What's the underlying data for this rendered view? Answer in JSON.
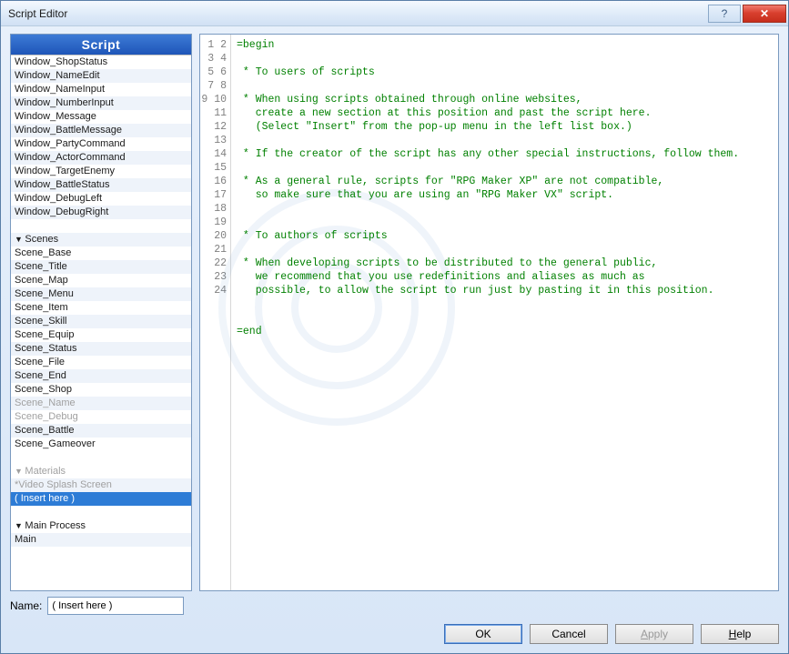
{
  "window": {
    "title": "Script Editor"
  },
  "titlebar": {
    "help_glyph": "?",
    "close_glyph": "✕"
  },
  "sidebar": {
    "header": "Script",
    "items": [
      {
        "label": "Window_ShopStatus",
        "type": "item"
      },
      {
        "label": "Window_NameEdit",
        "type": "item"
      },
      {
        "label": "Window_NameInput",
        "type": "item"
      },
      {
        "label": "Window_NumberInput",
        "type": "item"
      },
      {
        "label": "Window_Message",
        "type": "item"
      },
      {
        "label": "Window_BattleMessage",
        "type": "item"
      },
      {
        "label": "Window_PartyCommand",
        "type": "item"
      },
      {
        "label": "Window_ActorCommand",
        "type": "item"
      },
      {
        "label": "Window_TargetEnemy",
        "type": "item"
      },
      {
        "label": "Window_BattleStatus",
        "type": "item"
      },
      {
        "label": "Window_DebugLeft",
        "type": "item"
      },
      {
        "label": "Window_DebugRight",
        "type": "item"
      },
      {
        "label": "",
        "type": "blank"
      },
      {
        "label": "Scenes",
        "type": "header"
      },
      {
        "label": "Scene_Base",
        "type": "item"
      },
      {
        "label": "Scene_Title",
        "type": "item"
      },
      {
        "label": "Scene_Map",
        "type": "item"
      },
      {
        "label": "Scene_Menu",
        "type": "item"
      },
      {
        "label": "Scene_Item",
        "type": "item"
      },
      {
        "label": "Scene_Skill",
        "type": "item"
      },
      {
        "label": "Scene_Equip",
        "type": "item"
      },
      {
        "label": "Scene_Status",
        "type": "item"
      },
      {
        "label": "Scene_File",
        "type": "item"
      },
      {
        "label": "Scene_End",
        "type": "item"
      },
      {
        "label": "Scene_Shop",
        "type": "item"
      },
      {
        "label": "Scene_Name",
        "type": "dim"
      },
      {
        "label": "Scene_Debug",
        "type": "dim"
      },
      {
        "label": "Scene_Battle",
        "type": "item"
      },
      {
        "label": "Scene_Gameover",
        "type": "item"
      },
      {
        "label": "",
        "type": "blank"
      },
      {
        "label": "Materials",
        "type": "dimheader"
      },
      {
        "label": "*Video Splash Screen",
        "type": "dim"
      },
      {
        "label": "( Insert here )",
        "type": "selected"
      },
      {
        "label": "",
        "type": "blank"
      },
      {
        "label": "Main Process",
        "type": "header"
      },
      {
        "label": "Main",
        "type": "item"
      },
      {
        "label": "",
        "type": "blank"
      }
    ]
  },
  "code": {
    "lines": [
      "=begin",
      "",
      " * To users of scripts",
      "",
      " * When using scripts obtained through online websites,",
      "   create a new section at this position and past the script here.",
      "   (Select \"Insert\" from the pop-up menu in the left list box.)",
      "",
      " * If the creator of the script has any other special instructions, follow them.",
      "",
      " * As a general rule, scripts for \"RPG Maker XP\" are not compatible,",
      "   so make sure that you are using an \"RPG Maker VX\" script.",
      "",
      "",
      " * To authors of scripts",
      "",
      " * When developing scripts to be distributed to the general public,",
      "   we recommend that you use redefinitions and aliases as much as",
      "   possible, to allow the script to run just by pasting it in this position.",
      "",
      "",
      "=end",
      ""
    ],
    "start_line": 1,
    "visible_lines": 24
  },
  "name_field": {
    "label": "Name:",
    "value": "( Insert here )"
  },
  "buttons": {
    "ok": "OK",
    "cancel": "Cancel",
    "apply": "Apply",
    "help": "Help"
  }
}
